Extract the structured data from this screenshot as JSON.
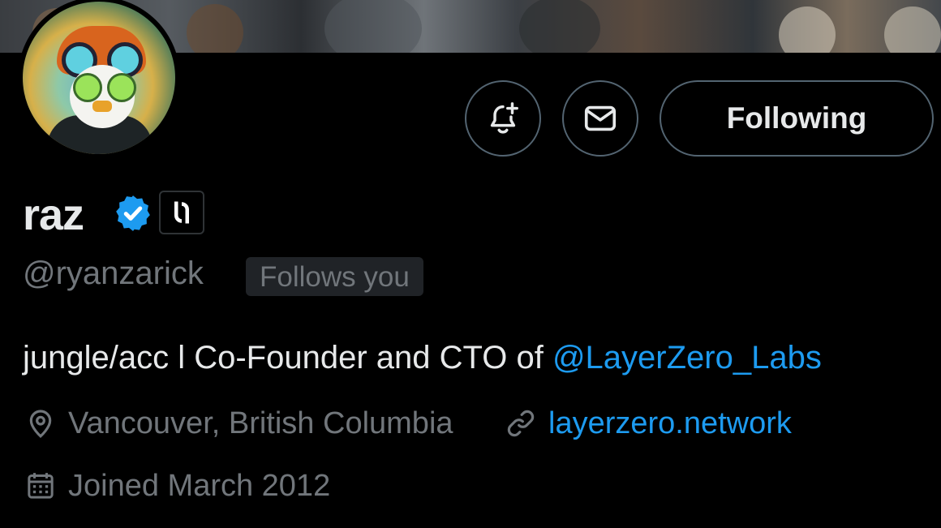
{
  "profile": {
    "display_name": "raz",
    "handle": "@ryanzarick",
    "follows_you": "Follows you",
    "verified_badge": "verified-checkmark-icon",
    "affiliate_badge": "layerzero-logo-icon"
  },
  "actions": {
    "notify_icon": "bell-plus-icon",
    "message_icon": "envelope-icon",
    "following_label": "Following"
  },
  "bio": {
    "text": "jungle/acc l Co-Founder and CTO of ",
    "mention": "@LayerZero_Labs"
  },
  "meta": {
    "location": "Vancouver, British Columbia",
    "website": "layerzero.network",
    "joined": "Joined March 2012"
  },
  "colors": {
    "background": "#000000",
    "text_primary": "#e7e9ea",
    "text_secondary": "#71767b",
    "accent": "#1d9bf0",
    "border": "#536471"
  }
}
